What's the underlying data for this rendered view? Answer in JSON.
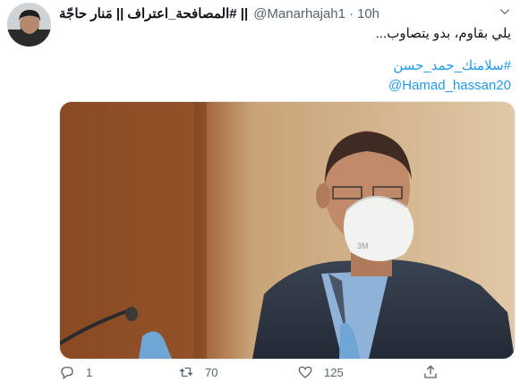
{
  "tweet": {
    "display_name": "|| #المصافحة_اعتراف || مَنار حاجّة",
    "handle": "@Manarhajah1",
    "separator": "·",
    "time": "10h",
    "body_text": "يلي بقاوم، بدو يتصاوب...",
    "hashtag": "#سلامتك_حمد_حسن",
    "mention": "@Hamad_hassan20"
  },
  "actions": {
    "reply_count": "1",
    "retweet_count": "70",
    "like_count": "125"
  },
  "icons": {
    "caret": "chevron-down-icon",
    "reply": "reply-icon",
    "retweet": "retweet-icon",
    "like": "heart-icon",
    "share": "share-icon"
  },
  "colors": {
    "link": "#1d9bf0",
    "secondary_text": "#536471"
  }
}
